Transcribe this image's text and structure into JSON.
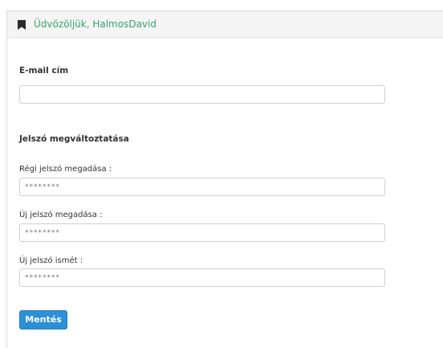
{
  "header": {
    "title": "Üdvözöljük, HalmosDavid",
    "icon": "bookmark-icon",
    "title_color": "#37a36b"
  },
  "email": {
    "label": "E-mail cím",
    "value": ""
  },
  "password_section": {
    "heading": "Jelszó megváltoztatása",
    "old_password": {
      "label": "Régi jelszó megadása :",
      "value": "********"
    },
    "new_password": {
      "label": "Új jelszó megadása :",
      "value": "********"
    },
    "new_password_repeat": {
      "label": "Új jelszó ismét :",
      "value": "********"
    }
  },
  "save_button": {
    "label": "Mentés",
    "color": "#2d8fd5"
  }
}
